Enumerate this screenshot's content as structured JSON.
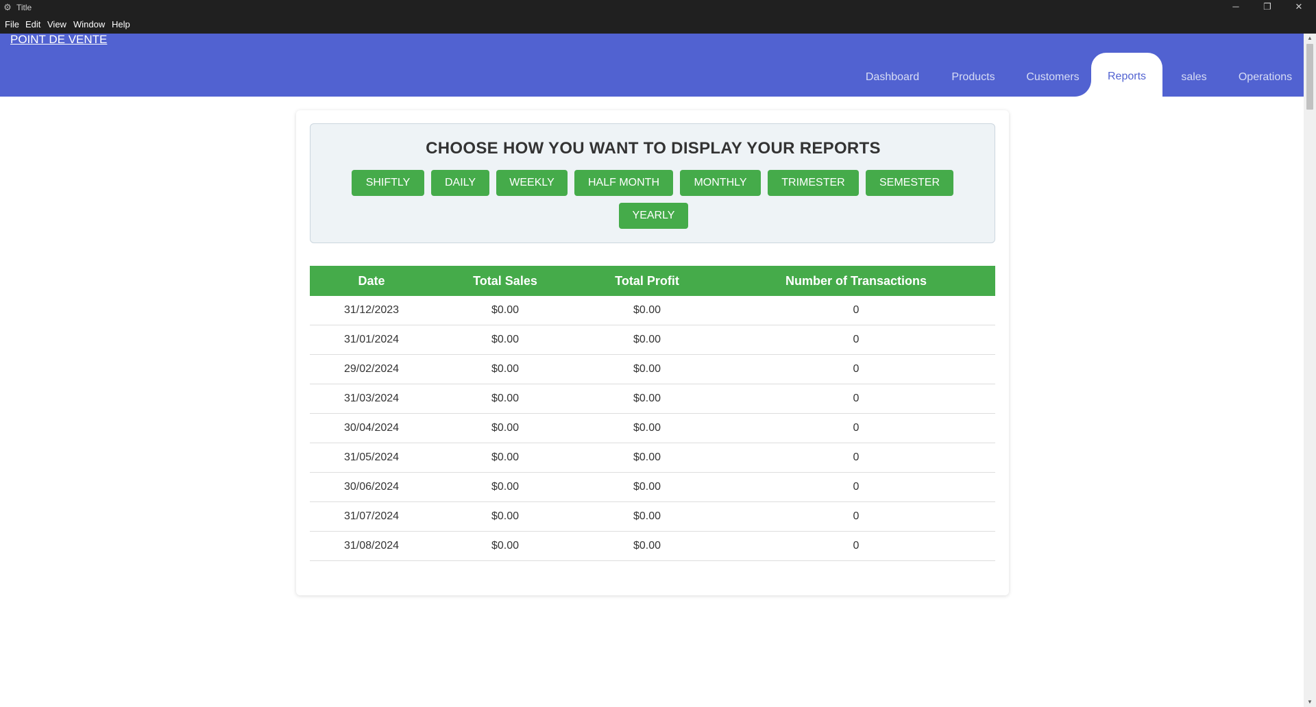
{
  "window": {
    "title": "Title",
    "controls": {
      "minimize": "─",
      "maximize": "❐",
      "close": "✕"
    }
  },
  "menu": [
    "File",
    "Edit",
    "View",
    "Window",
    "Help"
  ],
  "header": {
    "brand": "POINT DE VENTE",
    "nav": [
      "Dashboard",
      "Products",
      "Customers",
      "Reports",
      "sales",
      "Operations"
    ],
    "active": "Reports"
  },
  "chooser": {
    "title": "CHOOSE HOW YOU WANT TO DISPLAY YOUR REPORTS",
    "buttons": [
      "SHIFTLY",
      "DAILY",
      "WEEKLY",
      "HALF MONTH",
      "MONTHLY",
      "TRIMESTER",
      "SEMESTER",
      "YEARLY"
    ]
  },
  "table": {
    "headers": [
      "Date",
      "Total Sales",
      "Total Profit",
      "Number of Transactions"
    ],
    "rows": [
      [
        "31/12/2023",
        "$0.00",
        "$0.00",
        "0"
      ],
      [
        "31/01/2024",
        "$0.00",
        "$0.00",
        "0"
      ],
      [
        "29/02/2024",
        "$0.00",
        "$0.00",
        "0"
      ],
      [
        "31/03/2024",
        "$0.00",
        "$0.00",
        "0"
      ],
      [
        "30/04/2024",
        "$0.00",
        "$0.00",
        "0"
      ],
      [
        "31/05/2024",
        "$0.00",
        "$0.00",
        "0"
      ],
      [
        "30/06/2024",
        "$0.00",
        "$0.00",
        "0"
      ],
      [
        "31/07/2024",
        "$0.00",
        "$0.00",
        "0"
      ],
      [
        "31/08/2024",
        "$0.00",
        "$0.00",
        "0"
      ]
    ]
  },
  "colors": {
    "header_bg": "#5162d1",
    "button_green": "#45ab4a",
    "titlebar": "#202020"
  }
}
